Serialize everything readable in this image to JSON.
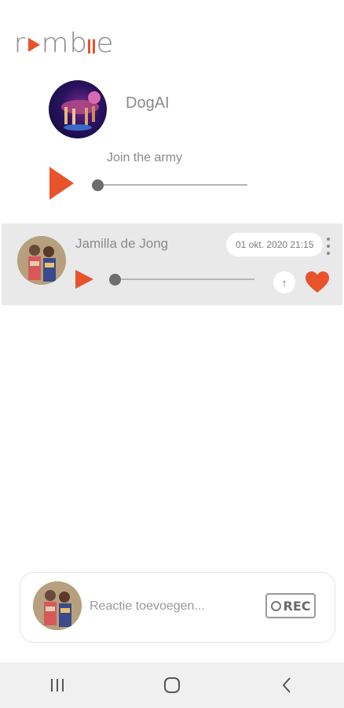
{
  "app": {
    "logo_text": "rmblle",
    "accent_color": "#e8532c"
  },
  "post": {
    "author": "DogAI",
    "title": "Join the army",
    "progress": 0
  },
  "comments": [
    {
      "author": "Jamilla de Jong",
      "date": "01 okt. 2020 21:15",
      "progress": 0,
      "liked": true
    }
  ],
  "composer": {
    "placeholder": "Reactie toevoegen...",
    "rec_label": "REC"
  },
  "navigation": {
    "buttons": [
      "recent-apps-icon",
      "home-icon",
      "back-icon"
    ]
  }
}
